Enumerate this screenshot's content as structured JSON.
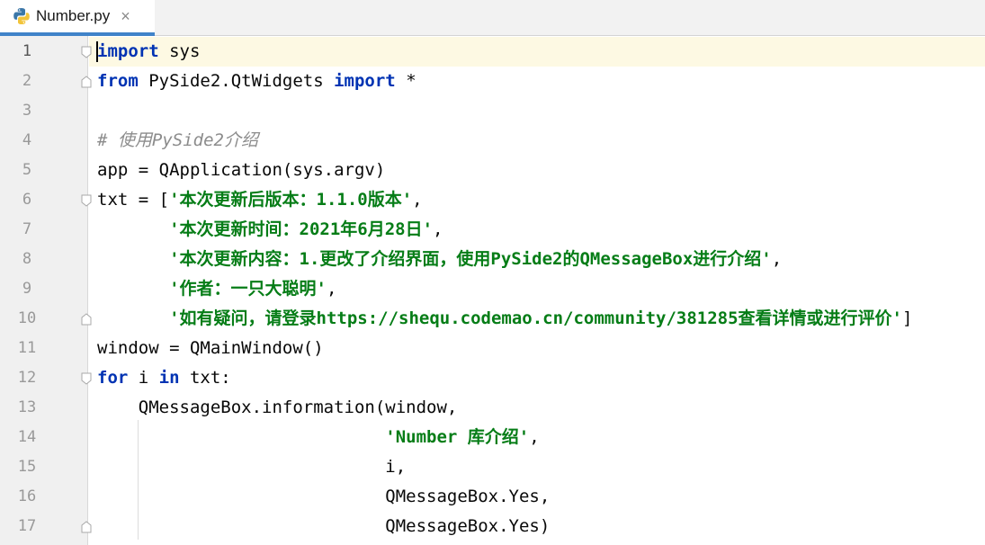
{
  "tab": {
    "filename": "Number.py",
    "close_glyph": "×",
    "icon": "python-file-icon"
  },
  "colors": {
    "keyword": "#0033b3",
    "string": "#067d17",
    "comment": "#8c8c8c",
    "tab_accent": "#4083c9",
    "current_line": "#fdf9e3"
  },
  "lines": [
    {
      "num": "1",
      "segs": [
        {
          "t": "import",
          "c": "kw"
        },
        {
          "t": " sys",
          "c": ""
        }
      ]
    },
    {
      "num": "2",
      "segs": [
        {
          "t": "from",
          "c": "kw"
        },
        {
          "t": " PySide2.QtWidgets ",
          "c": ""
        },
        {
          "t": "import",
          "c": "kw"
        },
        {
          "t": " *",
          "c": ""
        }
      ]
    },
    {
      "num": "3",
      "segs": []
    },
    {
      "num": "4",
      "segs": [
        {
          "t": "# 使用PySide2介绍",
          "c": "cmt"
        }
      ]
    },
    {
      "num": "5",
      "segs": [
        {
          "t": "app = QApplication(sys.argv)",
          "c": ""
        }
      ]
    },
    {
      "num": "6",
      "segs": [
        {
          "t": "txt = [",
          "c": ""
        },
        {
          "t": "'本次更新后版本：1.1.0版本'",
          "c": "str"
        },
        {
          "t": ",",
          "c": ""
        }
      ]
    },
    {
      "num": "7",
      "segs": [
        {
          "t": "       ",
          "c": ""
        },
        {
          "t": "'本次更新时间：2021年6月28日'",
          "c": "str"
        },
        {
          "t": ",",
          "c": ""
        }
      ]
    },
    {
      "num": "8",
      "segs": [
        {
          "t": "       ",
          "c": ""
        },
        {
          "t": "'本次更新内容：1.更改了介绍界面，使用PySide2的QMessageBox进行介绍'",
          "c": "str"
        },
        {
          "t": ",",
          "c": ""
        }
      ]
    },
    {
      "num": "9",
      "segs": [
        {
          "t": "       ",
          "c": ""
        },
        {
          "t": "'作者：一只大聪明'",
          "c": "str"
        },
        {
          "t": ",",
          "c": ""
        }
      ]
    },
    {
      "num": "10",
      "segs": [
        {
          "t": "       ",
          "c": ""
        },
        {
          "t": "'如有疑问，请登录https://shequ.codemao.cn/community/381285查看详情或进行评价'",
          "c": "str"
        },
        {
          "t": "]",
          "c": ""
        }
      ]
    },
    {
      "num": "11",
      "segs": [
        {
          "t": "window = QMainWindow()",
          "c": ""
        }
      ]
    },
    {
      "num": "12",
      "segs": [
        {
          "t": "for",
          "c": "kw"
        },
        {
          "t": " i ",
          "c": ""
        },
        {
          "t": "in",
          "c": "kw"
        },
        {
          "t": " txt:",
          "c": ""
        }
      ]
    },
    {
      "num": "13",
      "segs": [
        {
          "t": "    QMessageBox.information(window,",
          "c": ""
        }
      ]
    },
    {
      "num": "14",
      "segs": [
        {
          "t": "                            ",
          "c": ""
        },
        {
          "t": "'Number 库介绍'",
          "c": "str"
        },
        {
          "t": ",",
          "c": ""
        }
      ]
    },
    {
      "num": "15",
      "segs": [
        {
          "t": "                            i,",
          "c": ""
        }
      ]
    },
    {
      "num": "16",
      "segs": [
        {
          "t": "                            QMessageBox.Yes,",
          "c": ""
        }
      ]
    },
    {
      "num": "17",
      "segs": [
        {
          "t": "                            QMessageBox.Yes)",
          "c": ""
        }
      ]
    }
  ],
  "fold_markers": [
    {
      "line": 1,
      "kind": "start"
    },
    {
      "line": 2,
      "kind": "end"
    },
    {
      "line": 6,
      "kind": "start"
    },
    {
      "line": 10,
      "kind": "end"
    },
    {
      "line": 12,
      "kind": "start"
    },
    {
      "line": 17,
      "kind": "end"
    }
  ]
}
